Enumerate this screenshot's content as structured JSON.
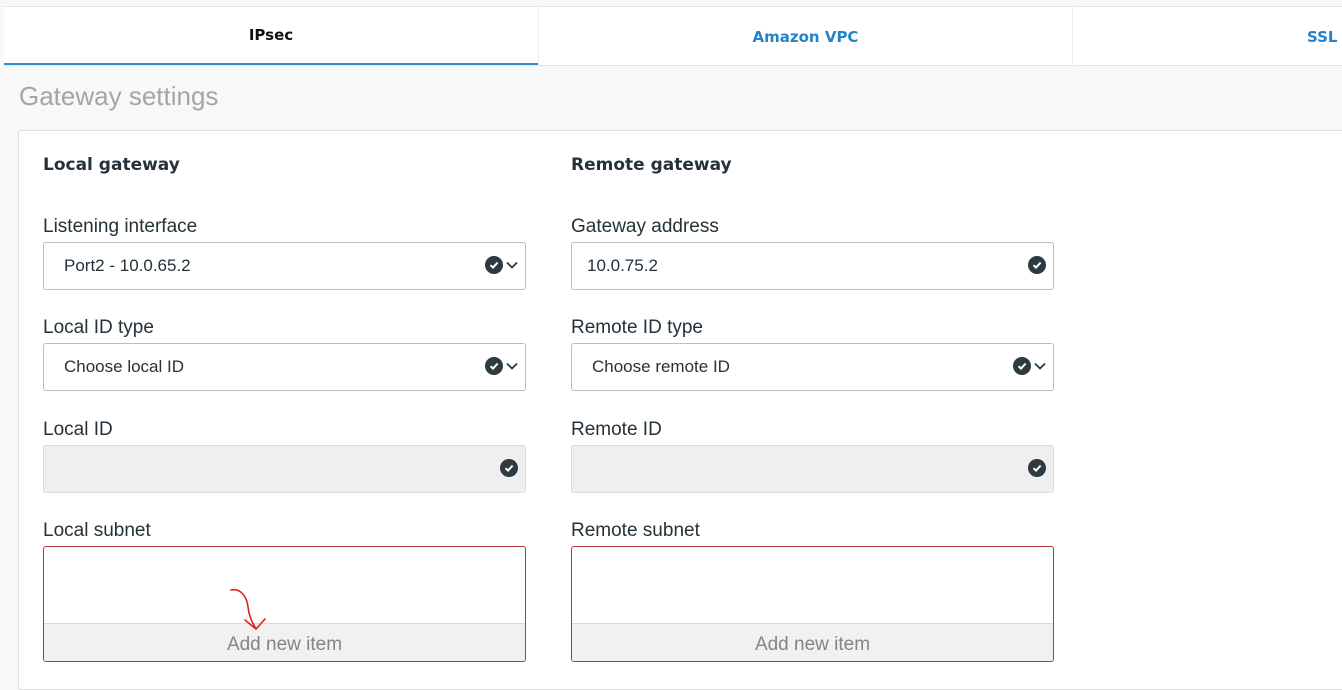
{
  "tabs": [
    {
      "label": "IPsec",
      "active": true
    },
    {
      "label": "Amazon VPC",
      "active": false
    },
    {
      "label": "SSL VPN",
      "active": false
    }
  ],
  "section_title": "Gateway settings",
  "local": {
    "heading": "Local gateway",
    "listening_interface": {
      "label": "Listening interface",
      "value": "Port2 - 10.0.65.2"
    },
    "id_type": {
      "label": "Local ID type",
      "value": "Choose local ID"
    },
    "id": {
      "label": "Local ID",
      "value": ""
    },
    "subnet": {
      "label": "Local subnet",
      "add_label": "Add new item"
    }
  },
  "remote": {
    "heading": "Remote gateway",
    "gateway_address": {
      "label": "Gateway address",
      "value": "10.0.75.2"
    },
    "id_type": {
      "label": "Remote ID type",
      "value": "Choose remote ID"
    },
    "id": {
      "label": "Remote ID",
      "value": ""
    },
    "subnet": {
      "label": "Remote subnet",
      "add_label": "Add new item"
    }
  },
  "colors": {
    "accent": "#2383c6",
    "tab_underline": "#2e8ccf",
    "error_border": "#b03a3a",
    "annotation": "#e02020"
  },
  "icons": {
    "valid": "check-circle-icon",
    "dropdown": "chevron-down-icon",
    "annotation": "red-arrow-annotation"
  }
}
